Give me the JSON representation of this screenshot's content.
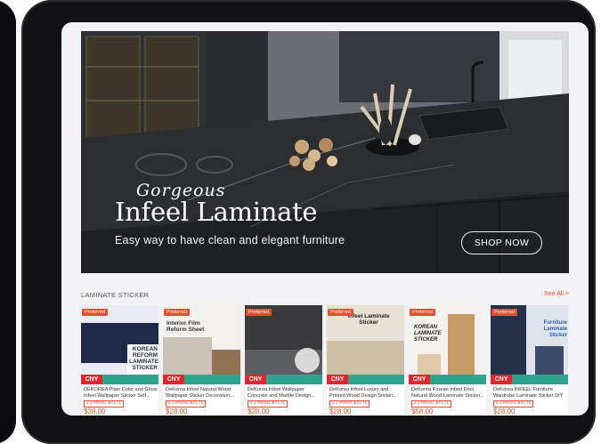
{
  "banner": {
    "script_text": "Gorgeous",
    "headline": "Infeel Laminate",
    "tagline": "Easy way to have clean and elegant furniture",
    "cta_label": "SHOP NOW"
  },
  "section": {
    "title": "LAMINATE STICKER",
    "see_all": "See All >"
  },
  "products": [
    {
      "name": "DEKOREA Plain Color and Gloss Infeel Wallpaper Sticker Self...",
      "promo": "2.2 PROD. $71.71",
      "price": "$28.00",
      "image_text": "KOREAN REFORM LAMINATE STICKER",
      "badge": "Preferred",
      "cny": "CNY",
      "accent": "#1e2a46"
    },
    {
      "name": "DeKorea Infeel Natural Wood Wallpaper Sticker Decoration...",
      "promo": "2.2 PROD. $71.71",
      "price": "$28.00",
      "image_text": "Interior Film Reform Sheet",
      "badge": "Preferred",
      "cny": "CNY",
      "accent": "#c9c2b6"
    },
    {
      "name": "DeKorea Infeel Wallpaper Concrete and Marble Design...",
      "promo": "2.2 PROD. $71.71",
      "price": "$28.00",
      "image_text": "",
      "badge": "Preferred",
      "cny": "CNY",
      "accent": "#3a3a3c"
    },
    {
      "name": "DeKorea Infeel Luxury and Printed Wood Design Sticker...",
      "promo": "2.2 PROD. $71.71",
      "price": "$28.00",
      "image_text": "Infeel Laminate Sticker",
      "badge": "Preferred",
      "cny": "CNY",
      "accent": "#e8e2d6"
    },
    {
      "name": "DeKorea Korean Infeel Door Natural Wood Laminate Sticker...",
      "promo": "2.2 PROD. $71.71",
      "price": "$58.00",
      "image_text": "KOREAN LAMINATE STICKER",
      "badge": "Preferred",
      "cny": "CNY",
      "accent": "#b98a5a"
    },
    {
      "name": "DeKorea INFEEL Furniture Wardrobe Laminate Sticker DIY",
      "promo": "2.2 PROD. $71.71",
      "price": "$28.00",
      "image_text": "Furniture Laminate Sticker",
      "badge": "Preferred",
      "cny": "CNY",
      "accent": "#253149"
    }
  ]
}
